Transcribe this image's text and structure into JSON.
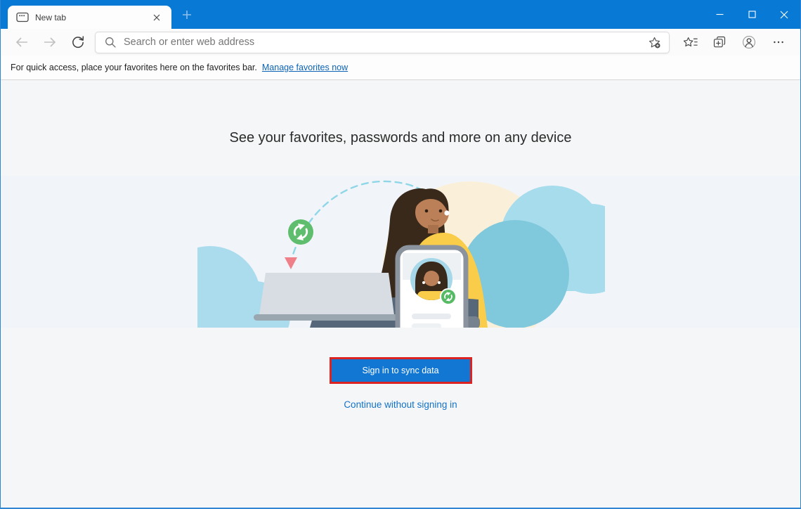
{
  "titlebar": {
    "tab_label": "New tab",
    "new_tab_button": "+"
  },
  "toolbar": {
    "address_placeholder": "Search or enter web address"
  },
  "favorites_bar": {
    "message": "For quick access, place your favorites here on the favorites bar.",
    "link_label": "Manage favorites now"
  },
  "main": {
    "heading": "See your favorites, passwords and more on any device",
    "sign_in_label": "Sign in to sync data",
    "continue_label": "Continue without signing in"
  },
  "colors": {
    "titlebar_blue": "#0879d4",
    "button_blue": "#1177d2",
    "annotation_red": "#dd2222",
    "link_blue": "#0c63b6",
    "band_background": "#f1f5fa",
    "page_background": "#f5f6f7",
    "illustration_cloud_light": "#a6dcec",
    "illustration_cloud_dark": "#80c8dc",
    "illustration_cream": "#faf0da",
    "illustration_green": "#5fbe6d",
    "illustration_yellow": "#f9cd49"
  },
  "icons": [
    "new-tab-page-icon",
    "tab-close-icon",
    "new-tab-plus-icon",
    "minimize-icon",
    "maximize-icon",
    "window-close-icon",
    "back-icon",
    "forward-icon",
    "refresh-icon",
    "search-icon",
    "add-favorite-icon",
    "favorites-icon",
    "collections-icon",
    "profile-icon",
    "settings-ellipsis-icon",
    "sync-icon"
  ]
}
